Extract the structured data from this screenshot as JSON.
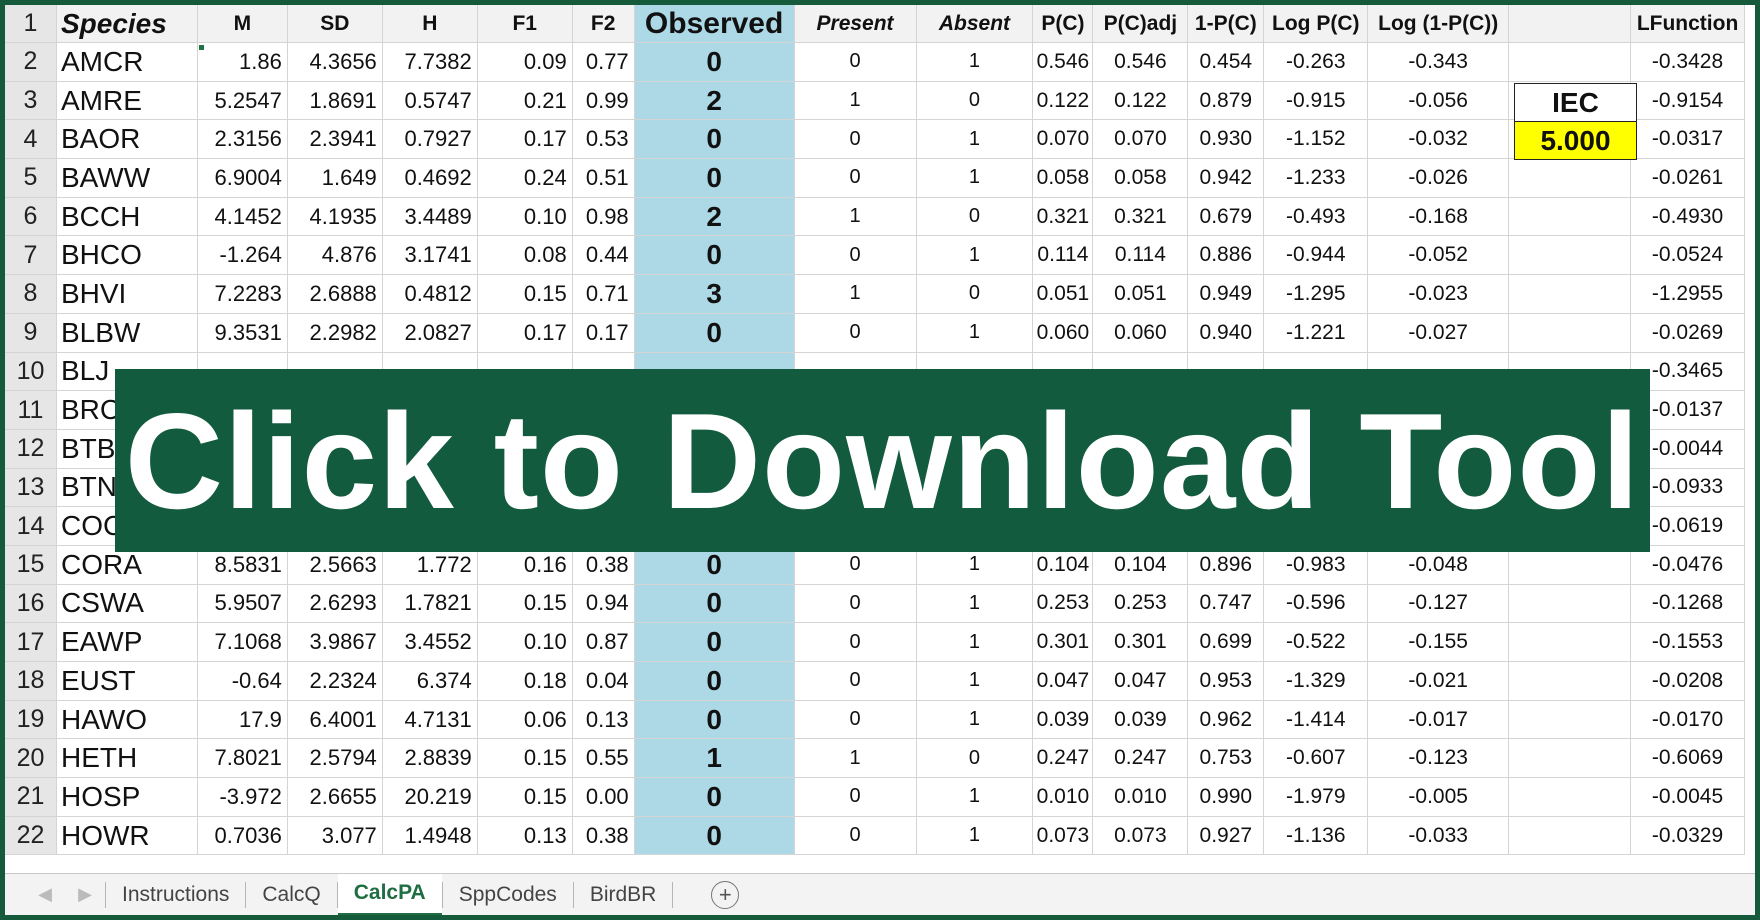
{
  "columns": {
    "row_num": "1",
    "species": "Species",
    "m": "M",
    "sd": "SD",
    "h": "H",
    "f1": "F1",
    "f2": "F2",
    "observed": "Observed",
    "present": "Present",
    "absent": "Absent",
    "pc": "P(C)",
    "pcadj": "P(C)adj",
    "one_minus_pc": "1-P(C)",
    "log_pc": "Log P(C)",
    "log_one_minus_pc": "Log (1-P(C))",
    "blank": "",
    "lfunction": "LFunction"
  },
  "rows": [
    {
      "n": "2",
      "species": "AMCR",
      "m": "1.86",
      "sd": "4.3656",
      "h": "7.7382",
      "f1": "0.09",
      "f2": "0.77",
      "observed": "0",
      "present": "0",
      "absent": "1",
      "pc": "0.546",
      "pcadj": "0.546",
      "one_minus_pc": "0.454",
      "log_pc": "-0.263",
      "log_one_minus_pc": "-0.343",
      "lfunction": "-0.3428"
    },
    {
      "n": "3",
      "species": "AMRE",
      "m": "5.2547",
      "sd": "1.8691",
      "h": "0.5747",
      "f1": "0.21",
      "f2": "0.99",
      "observed": "2",
      "present": "1",
      "absent": "0",
      "pc": "0.122",
      "pcadj": "0.122",
      "one_minus_pc": "0.879",
      "log_pc": "-0.915",
      "log_one_minus_pc": "-0.056",
      "lfunction": "-0.9154"
    },
    {
      "n": "4",
      "species": "BAOR",
      "m": "2.3156",
      "sd": "2.3941",
      "h": "0.7927",
      "f1": "0.17",
      "f2": "0.53",
      "observed": "0",
      "present": "0",
      "absent": "1",
      "pc": "0.070",
      "pcadj": "0.070",
      "one_minus_pc": "0.930",
      "log_pc": "-1.152",
      "log_one_minus_pc": "-0.032",
      "lfunction": "-0.0317"
    },
    {
      "n": "5",
      "species": "BAWW",
      "m": "6.9004",
      "sd": "1.649",
      "h": "0.4692",
      "f1": "0.24",
      "f2": "0.51",
      "observed": "0",
      "present": "0",
      "absent": "1",
      "pc": "0.058",
      "pcadj": "0.058",
      "one_minus_pc": "0.942",
      "log_pc": "-1.233",
      "log_one_minus_pc": "-0.026",
      "lfunction": "-0.0261"
    },
    {
      "n": "6",
      "species": "BCCH",
      "m": "4.1452",
      "sd": "4.1935",
      "h": "3.4489",
      "f1": "0.10",
      "f2": "0.98",
      "observed": "2",
      "present": "1",
      "absent": "0",
      "pc": "0.321",
      "pcadj": "0.321",
      "one_minus_pc": "0.679",
      "log_pc": "-0.493",
      "log_one_minus_pc": "-0.168",
      "lfunction": "-0.4930"
    },
    {
      "n": "7",
      "species": "BHCO",
      "m": "-1.264",
      "sd": "4.876",
      "h": "3.1741",
      "f1": "0.08",
      "f2": "0.44",
      "observed": "0",
      "present": "0",
      "absent": "1",
      "pc": "0.114",
      "pcadj": "0.114",
      "one_minus_pc": "0.886",
      "log_pc": "-0.944",
      "log_one_minus_pc": "-0.052",
      "lfunction": "-0.0524"
    },
    {
      "n": "8",
      "species": "BHVI",
      "m": "7.2283",
      "sd": "2.6888",
      "h": "0.4812",
      "f1": "0.15",
      "f2": "0.71",
      "observed": "3",
      "present": "1",
      "absent": "0",
      "pc": "0.051",
      "pcadj": "0.051",
      "one_minus_pc": "0.949",
      "log_pc": "-1.295",
      "log_one_minus_pc": "-0.023",
      "lfunction": "-1.2955"
    },
    {
      "n": "9",
      "species": "BLBW",
      "m": "9.3531",
      "sd": "2.2982",
      "h": "2.0827",
      "f1": "0.17",
      "f2": "0.17",
      "observed": "0",
      "present": "0",
      "absent": "1",
      "pc": "0.060",
      "pcadj": "0.060",
      "one_minus_pc": "0.940",
      "log_pc": "-1.221",
      "log_one_minus_pc": "-0.027",
      "lfunction": "-0.0269"
    },
    {
      "n": "10",
      "species": "BLJ",
      "m": "",
      "sd": "",
      "h": "",
      "f1": "",
      "f2": "",
      "observed": "",
      "present": "",
      "absent": "",
      "pc": "",
      "pcadj": "",
      "one_minus_pc": "",
      "log_pc": "",
      "log_one_minus_pc": "",
      "lfunction": "-0.3465"
    },
    {
      "n": "11",
      "species": "BRC",
      "m": "",
      "sd": "",
      "h": "",
      "f1": "",
      "f2": "",
      "observed": "",
      "present": "",
      "absent": "",
      "pc": "",
      "pcadj": "",
      "one_minus_pc": "",
      "log_pc": "",
      "log_one_minus_pc": "",
      "lfunction": "-0.0137"
    },
    {
      "n": "12",
      "species": "BTB",
      "m": "",
      "sd": "",
      "h": "",
      "f1": "",
      "f2": "",
      "observed": "",
      "present": "",
      "absent": "",
      "pc": "",
      "pcadj": "",
      "one_minus_pc": "",
      "log_pc": "",
      "log_one_minus_pc": "",
      "lfunction": "-0.0044"
    },
    {
      "n": "13",
      "species": "BTN",
      "m": "",
      "sd": "",
      "h": "",
      "f1": "",
      "f2": "",
      "observed": "",
      "present": "",
      "absent": "",
      "pc": "",
      "pcadj": "",
      "one_minus_pc": "",
      "log_pc": "",
      "log_one_minus_pc": "",
      "lfunction": "-0.0933"
    },
    {
      "n": "14",
      "species": "COC",
      "m": "",
      "sd": "",
      "h": "",
      "f1": "",
      "f2": "",
      "observed": "",
      "present": "",
      "absent": "",
      "pc": "",
      "pcadj": "",
      "one_minus_pc": "",
      "log_pc": "",
      "log_one_minus_pc": "",
      "lfunction": "-0.0619"
    },
    {
      "n": "15",
      "species": "CORA",
      "m": "8.5831",
      "sd": "2.5663",
      "h": "1.772",
      "f1": "0.16",
      "f2": "0.38",
      "observed": "0",
      "present": "0",
      "absent": "1",
      "pc": "0.104",
      "pcadj": "0.104",
      "one_minus_pc": "0.896",
      "log_pc": "-0.983",
      "log_one_minus_pc": "-0.048",
      "lfunction": "-0.0476"
    },
    {
      "n": "16",
      "species": "CSWA",
      "m": "5.9507",
      "sd": "2.6293",
      "h": "1.7821",
      "f1": "0.15",
      "f2": "0.94",
      "observed": "0",
      "present": "0",
      "absent": "1",
      "pc": "0.253",
      "pcadj": "0.253",
      "one_minus_pc": "0.747",
      "log_pc": "-0.596",
      "log_one_minus_pc": "-0.127",
      "lfunction": "-0.1268"
    },
    {
      "n": "17",
      "species": "EAWP",
      "m": "7.1068",
      "sd": "3.9867",
      "h": "3.4552",
      "f1": "0.10",
      "f2": "0.87",
      "observed": "0",
      "present": "0",
      "absent": "1",
      "pc": "0.301",
      "pcadj": "0.301",
      "one_minus_pc": "0.699",
      "log_pc": "-0.522",
      "log_one_minus_pc": "-0.155",
      "lfunction": "-0.1553"
    },
    {
      "n": "18",
      "species": "EUST",
      "m": "-0.64",
      "sd": "2.2324",
      "h": "6.374",
      "f1": "0.18",
      "f2": "0.04",
      "observed": "0",
      "present": "0",
      "absent": "1",
      "pc": "0.047",
      "pcadj": "0.047",
      "one_minus_pc": "0.953",
      "log_pc": "-1.329",
      "log_one_minus_pc": "-0.021",
      "lfunction": "-0.0208"
    },
    {
      "n": "19",
      "species": "HAWO",
      "m": "17.9",
      "sd": "6.4001",
      "h": "4.7131",
      "f1": "0.06",
      "f2": "0.13",
      "observed": "0",
      "present": "0",
      "absent": "1",
      "pc": "0.039",
      "pcadj": "0.039",
      "one_minus_pc": "0.962",
      "log_pc": "-1.414",
      "log_one_minus_pc": "-0.017",
      "lfunction": "-0.0170"
    },
    {
      "n": "20",
      "species": "HETH",
      "m": "7.8021",
      "sd": "2.5794",
      "h": "2.8839",
      "f1": "0.15",
      "f2": "0.55",
      "observed": "1",
      "present": "1",
      "absent": "0",
      "pc": "0.247",
      "pcadj": "0.247",
      "one_minus_pc": "0.753",
      "log_pc": "-0.607",
      "log_one_minus_pc": "-0.123",
      "lfunction": "-0.6069"
    },
    {
      "n": "21",
      "species": "HOSP",
      "m": "-3.972",
      "sd": "2.6655",
      "h": "20.219",
      "f1": "0.15",
      "f2": "0.00",
      "observed": "0",
      "present": "0",
      "absent": "1",
      "pc": "0.010",
      "pcadj": "0.010",
      "one_minus_pc": "0.990",
      "log_pc": "-1.979",
      "log_one_minus_pc": "-0.005",
      "lfunction": "-0.0045"
    },
    {
      "n": "22",
      "species": "HOWR",
      "m": "0.7036",
      "sd": "3.077",
      "h": "1.4948",
      "f1": "0.13",
      "f2": "0.38",
      "observed": "0",
      "present": "0",
      "absent": "1",
      "pc": "0.073",
      "pcadj": "0.073",
      "one_minus_pc": "0.927",
      "log_pc": "-1.136",
      "log_one_minus_pc": "-0.033",
      "lfunction": "-0.0329"
    }
  ],
  "iec": {
    "label": "IEC",
    "value": "5.000"
  },
  "banner": {
    "text": "Click to Download Tool"
  },
  "tabs": [
    "Instructions",
    "CalcQ",
    "CalcPA",
    "SppCodes",
    "BirdBR"
  ],
  "active_tab": "CalcPA",
  "icons": {
    "scroll_left": "chevron-left-icon",
    "scroll_right": "chevron-right-icon",
    "add_sheet": "plus-circle-icon"
  },
  "colors": {
    "frame": "#165a3c",
    "banner": "#135b3f",
    "observed_fill": "#add8e6",
    "iec_fill": "#ffff00",
    "active_tab": "#1f6e43"
  }
}
